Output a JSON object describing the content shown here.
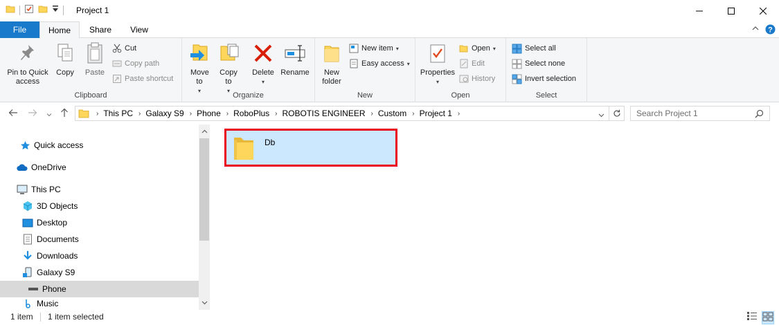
{
  "window": {
    "title": "Project 1",
    "controls": [
      "minimize",
      "maximize",
      "close"
    ]
  },
  "quick_access_toolbar": {
    "icons": [
      "folder-icon",
      "properties-check-icon",
      "new-folder-icon",
      "customize-dropdown-icon"
    ]
  },
  "ribbon_tabs": [
    {
      "label": "File",
      "active": false
    },
    {
      "label": "Home",
      "active": true
    },
    {
      "label": "Share",
      "active": false
    },
    {
      "label": "View",
      "active": false
    }
  ],
  "ribbon": {
    "clipboard": {
      "label": "Clipboard",
      "pin_to_quick_access": "Pin to Quick access",
      "copy": "Copy",
      "paste": "Paste",
      "cut": "Cut",
      "copy_path": "Copy path",
      "paste_shortcut": "Paste shortcut"
    },
    "organize": {
      "label": "Organize",
      "move_to": "Move to",
      "copy_to": "Copy to",
      "delete": "Delete",
      "rename": "Rename"
    },
    "new": {
      "label": "New",
      "new_folder": "New folder",
      "new_item": "New item",
      "easy_access": "Easy access"
    },
    "open": {
      "label": "Open",
      "properties": "Properties",
      "open": "Open",
      "edit": "Edit",
      "history": "History"
    },
    "select": {
      "label": "Select",
      "select_all": "Select all",
      "select_none": "Select none",
      "invert_selection": "Invert selection"
    }
  },
  "address_bar": {
    "breadcrumbs": [
      "This PC",
      "Galaxy S9",
      "Phone",
      "RoboPlus",
      "ROBOTIS ENGINEER",
      "Custom",
      "Project 1"
    ]
  },
  "search": {
    "placeholder": "Search Project 1"
  },
  "nav_pane": {
    "items": [
      {
        "label": "Quick access",
        "icon": "star-icon",
        "indent": 0,
        "selected": false
      },
      {
        "label": "OneDrive",
        "icon": "cloud-icon",
        "indent": 0,
        "selected": false
      },
      {
        "label": "This PC",
        "icon": "computer-icon",
        "indent": 0,
        "selected": false
      },
      {
        "label": "3D Objects",
        "icon": "cube-icon",
        "indent": 1,
        "selected": false
      },
      {
        "label": "Desktop",
        "icon": "desktop-icon",
        "indent": 1,
        "selected": false
      },
      {
        "label": "Documents",
        "icon": "document-icon",
        "indent": 1,
        "selected": false
      },
      {
        "label": "Downloads",
        "icon": "download-arrow-icon",
        "indent": 1,
        "selected": false
      },
      {
        "label": "Galaxy S9",
        "icon": "phone-device-icon",
        "indent": 1,
        "selected": false
      },
      {
        "label": "Phone",
        "icon": "drive-icon",
        "indent": 2,
        "selected": true
      },
      {
        "label": "Music",
        "icon": "music-note-icon",
        "indent": 1,
        "selected": false
      }
    ]
  },
  "files": [
    {
      "name": "Db",
      "type": "folder",
      "selected": true
    }
  ],
  "status_bar": {
    "item_count": "1 item",
    "selection": "1 item selected"
  },
  "colors": {
    "file_tab": "#1979ca",
    "selection": "#cce8ff",
    "highlight_border": "#e8001c",
    "folder": "#ffd65c"
  }
}
